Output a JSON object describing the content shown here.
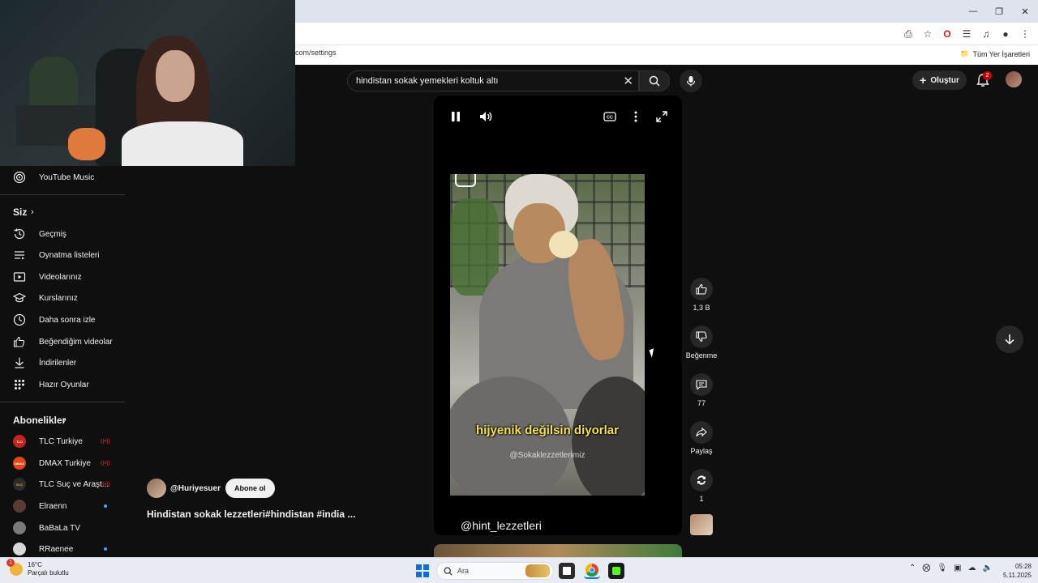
{
  "browser": {
    "address_fragment": "com/settings",
    "bookmarks_all": "Tüm Yer İşaretleri",
    "window_controls": [
      "minimize-icon",
      "restore-icon",
      "close-icon"
    ]
  },
  "header": {
    "search_query": "hindistan sokak yemekleri koltuk altı",
    "create_label": "Oluştur",
    "notification_count": "2"
  },
  "sidebar": {
    "music_label": "YouTube Music",
    "you_heading": "Siz",
    "you_items": [
      {
        "label": "Geçmiş",
        "icon": "history-icon"
      },
      {
        "label": "Oynatma listeleri",
        "icon": "playlist-icon"
      },
      {
        "label": "Videolarınız",
        "icon": "your-videos-icon"
      },
      {
        "label": "Kurslarınız",
        "icon": "courses-icon"
      },
      {
        "label": "Daha sonra izle",
        "icon": "watch-later-icon"
      },
      {
        "label": "Beğendiğim videolar",
        "icon": "liked-icon"
      },
      {
        "label": "İndirilenler",
        "icon": "download-icon"
      },
      {
        "label": "Hazır Oyunlar",
        "icon": "games-icon"
      }
    ],
    "subs_heading": "Abonelikler",
    "subscriptions": [
      {
        "label": "TLC Turkiye",
        "badge": "TLC",
        "color": "#c4241f",
        "status": "live"
      },
      {
        "label": "DMAX Turkiye",
        "badge": "DMAX",
        "color": "#e2491a",
        "status": "live"
      },
      {
        "label": "TLC Suç ve Araşt...",
        "badge": "SUÇ",
        "color": "#2c2c2c",
        "status": "live"
      },
      {
        "label": "Elraenn",
        "badge": "",
        "color": "#5a3b32",
        "status": "new"
      },
      {
        "label": "BaBaLa TV",
        "badge": "",
        "color": "#7a7a7a",
        "status": ""
      },
      {
        "label": "RRaenee",
        "badge": "",
        "color": "#d9d9d9",
        "status": "new"
      }
    ]
  },
  "short": {
    "caption": "hijyenik değilsin diyorlar",
    "watermark": "@Sokaklezzetlerimiz",
    "channel_handle": "@hint_lezzetleri",
    "likes": "1,3 B",
    "dislike_label": "Beğenme",
    "comments": "77",
    "share_label": "Paylaş",
    "remix_count": "1",
    "author": "@Huriyesuer",
    "subscribe_label": "Abone ol",
    "title": "Hindistan sokak lezzetleri#hindistan #india ..."
  },
  "taskbar": {
    "temperature": "16°C",
    "weather_desc": "Parçalı bulutlu",
    "weather_alert": "1",
    "search_placeholder": "Ara",
    "time": "05:28",
    "date": "5.11.2025"
  }
}
